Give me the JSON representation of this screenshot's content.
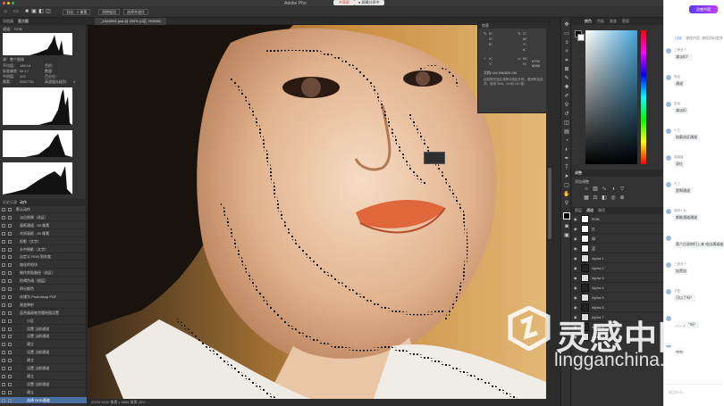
{
  "titlebar": {
    "app_title": "Adobe Pho",
    "record_label": "共享屏",
    "share_label": "● 屏幕分享中",
    "colors": {
      "close": "#ff5f57",
      "min": "#febc2e",
      "max": "#28c840"
    }
  },
  "options_bar": {
    "buttons": [
      "羽化：0 像素",
      "消除锯齿",
      "选择并遮住"
    ]
  },
  "left_panel": {
    "tabs": [
      "导航器",
      "直方图"
    ],
    "channel_label": "通道：",
    "channel_value": "RGB",
    "source_label": "源：整个图像",
    "stats": [
      {
        "k": "平均值：",
        "v": "189.14"
      },
      {
        "k": "标准偏差：",
        "v": "54.17"
      },
      {
        "k": "中间值：",
        "v": "202"
      },
      {
        "k": "像素：",
        "v": "2557735"
      }
    ],
    "stats_right": [
      {
        "k": "色阶：",
        "v": ""
      },
      {
        "k": "数量：",
        "v": ""
      },
      {
        "k": "百分位：",
        "v": ""
      },
      {
        "k": "高速缓存级别：",
        "v": "4"
      }
    ],
    "history_tabs": [
      "历史记录",
      "动作"
    ],
    "history": [
      "默认动作",
      "淡出效果（选区）",
      "画框通道 - 50 像素",
      "木质画框 - 50 像素",
      "投影（文字）",
      "水中倒影（文字）",
      "自定义 RGB 到灰度",
      "熔化的铅块",
      "制作剪贴路径（选区）",
      "棕褐色调（图层）",
      "四分颜色",
      "存储为 Photoshop PDF",
      "渐变映射",
      "混合器画笔克隆绘图设置",
      "小区",
      "设置 当前通道",
      "设置 当前通道",
      "建立",
      "设置 当前通道",
      "建立",
      "设置 当前通道",
      "建立",
      "设置 当前通道",
      "建立",
      "选择 RGB通道"
    ]
  },
  "document": {
    "tab_label": "_1SA0951.psd @ 200% (U区, RGB/8)",
    "status": "200%   5152 像素 x 6688 像素 (300 ..."
  },
  "picker": {
    "title": "信息",
    "r_label": "R：",
    "g_label": "G：",
    "b_label": "B：",
    "c_label": "C：",
    "m_label": "M：",
    "y_label": "Y：",
    "k_label": "K：",
    "x_label": "X：",
    "y2_label": "Y：",
    "w_label": "W：",
    "h_label": "H：",
    "xy_values": "5792\n6088",
    "doc_size": "文档:144.0M/820.0M",
    "note": "绘制矩形选区或移动选区外框。要用附加选项，使用 Shift、Alt 和 Ctrl 键。"
  },
  "right_panel": {
    "tabs": [
      "颜色",
      "色板",
      "渐变",
      "图案"
    ],
    "adjust_title": "调整",
    "adjust_sub": "添加调整",
    "layer_tabs": [
      "图层",
      "通道",
      "路径"
    ],
    "layers": [
      "RGB",
      "红",
      "绿",
      "蓝",
      "Alpha 1",
      "Alpha 2",
      "Alpha 3",
      "Alpha 4",
      "Alpha 5",
      "Alpha 6",
      "Alpha 7",
      "Alpha 8",
      "Alpha 9"
    ]
  },
  "chat": {
    "logo": "灵感中国",
    "tabs": [
      "讨论",
      "课程内容",
      "课程资料",
      "更多"
    ],
    "messages": [
      {
        "name": "三美多少",
        "text": "减淡扣？"
      },
      {
        "name": "猫宝",
        "text": "通道"
      },
      {
        "name": "猫宝",
        "text": "减淡扣"
      },
      {
        "name": "小白",
        "text": "加载选区通道"
      },
      {
        "name": "猫酱酱",
        "text": "双红"
      },
      {
        "name": "天工",
        "text": "是啊通道"
      },
      {
        "name": "猫咪小仙",
        "text": "都能通道通道"
      },
      {
        "name": "",
        "text": "第六位说他们上来 给出通道道"
      },
      {
        "name": "三美多少",
        "text": "加黑加"
      },
      {
        "name": "子盈",
        "text": "可以了吗？"
      },
      {
        "name": "",
        "text": "对于看了吗？"
      },
      {
        "name": "",
        "text": "嗯嗯"
      }
    ],
    "input_placeholder": "说点什么..."
  },
  "watermark": {
    "brand": "灵感中国",
    "url": "lingganchina.com"
  }
}
